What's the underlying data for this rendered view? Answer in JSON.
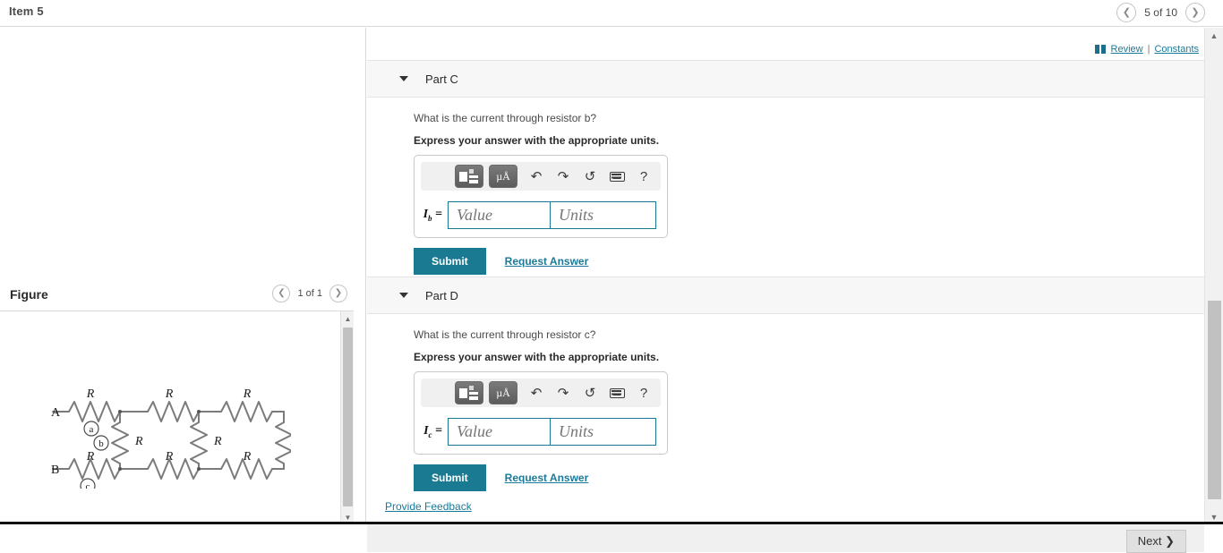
{
  "header": {
    "item_title": "Item 5",
    "pager": {
      "prev_icon": "chevron-left",
      "label": "5 of 10",
      "next_icon": "chevron-right"
    }
  },
  "toplinks": {
    "book_icon": "book-icon",
    "review": "Review",
    "separator": "|",
    "constants": "Constants"
  },
  "figure": {
    "title": "Figure",
    "pager": {
      "prev_icon": "chevron-left",
      "label": "1 of 1",
      "next_icon": "chevron-right"
    },
    "circuit": {
      "terminal_a": "A",
      "terminal_b": "B",
      "node_a": "a",
      "node_b": "b",
      "node_c": "c",
      "resistor_label": "R",
      "description": "Ladder network of nine resistors labelled R between terminals A and B"
    }
  },
  "parts": [
    {
      "id": "part-c",
      "label": "Part C",
      "question": "What is the current through resistor b?",
      "instruction": "Express your answer with the appropriate units.",
      "symbol": "I",
      "symbol_sub": "b",
      "equals": "=",
      "value_placeholder": "Value",
      "units_placeholder": "Units",
      "value": "",
      "units": "",
      "toolbar": {
        "template_button": "template-icon",
        "units_button": "µÅ",
        "undo": "↶",
        "redo": "↷",
        "reset": "↺",
        "keyboard": "keyboard-icon",
        "help": "?"
      },
      "submit_label": "Submit",
      "request_answer_label": "Request Answer"
    },
    {
      "id": "part-d",
      "label": "Part D",
      "question": "What is the current through resistor c?",
      "instruction": "Express your answer with the appropriate units.",
      "symbol": "I",
      "symbol_sub": "c",
      "equals": "=",
      "value_placeholder": "Value",
      "units_placeholder": "Units",
      "value": "",
      "units": "",
      "toolbar": {
        "template_button": "template-icon",
        "units_button": "µÅ",
        "undo": "↶",
        "redo": "↷",
        "reset": "↺",
        "keyboard": "keyboard-icon",
        "help": "?"
      },
      "submit_label": "Submit",
      "request_answer_label": "Request Answer"
    }
  ],
  "footer": {
    "feedback_label": "Provide Feedback",
    "next_label": "Next ❯"
  },
  "colors": {
    "accent": "#1a7a92",
    "link": "#1a7a9a",
    "input_border": "#17788f",
    "panel_bg": "#f7f7f7"
  }
}
